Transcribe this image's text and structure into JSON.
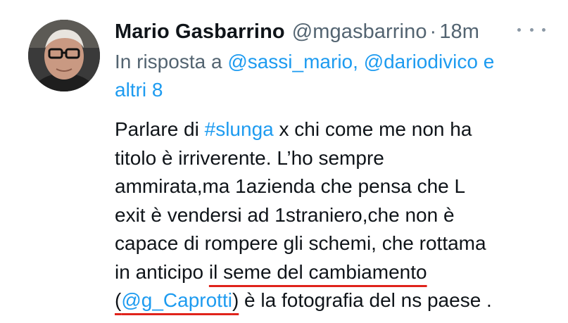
{
  "tweet": {
    "author": {
      "display_name": "Mario Gasbarrino",
      "handle": "@mgasbarrino",
      "separator": "·",
      "time": "18m",
      "avatar_icon": "profile-photo"
    },
    "more_icon": "more-options-icon",
    "reply": {
      "prefix": "In risposta a",
      "mention1": "@sassi_mario,",
      "mention2": "@dariodivico",
      "conjunction": "e",
      "others": "altri 8"
    },
    "text": {
      "l1_a": "Parlare di ",
      "l1_hashtag": "#slunga",
      "l1_b": " x chi come me non ha",
      "l2": "titolo è irriverente. L’ho sempre",
      "l3": "ammirata,ma 1azienda che pensa che L",
      "l4": "exit è vendersi ad 1straniero,che non è",
      "l5": "capace di rompere gli schemi, che rottama",
      "l6_a": "in anticipo ",
      "l6_underlined": "il seme del cambiamento",
      "l7_open": "(",
      "l7_mention": "@g_Caprotti",
      "l7_close": ")",
      "l7_b": " è la fotografia del ns paese ."
    },
    "colors": {
      "link": "#1d9bf0",
      "secondary": "#536471",
      "underline_annotation": "#e0231b"
    }
  }
}
